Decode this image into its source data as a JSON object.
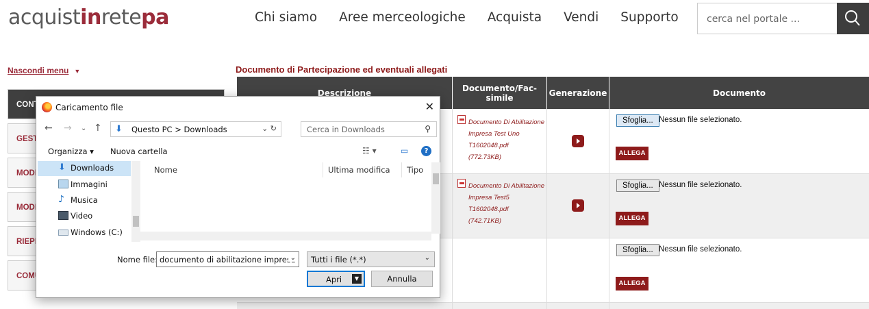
{
  "header": {
    "logo_part1": "acquist",
    "logo_part2": "in",
    "logo_part3": "rete",
    "logo_part4": "pa",
    "nav": [
      "Chi siamo",
      "Aree merceologiche",
      "Acquista",
      "Vendi",
      "Supporto"
    ],
    "search_placeholder": "cerca nel portale ...",
    "search_icon": "search-icon"
  },
  "sidebar": {
    "hide_menu": "Nascondi menu",
    "items": [
      "CONT",
      "GEST",
      "MODI",
      "MODI",
      "RIEPI",
      "COMU"
    ]
  },
  "main": {
    "title": "Documento di Partecipazione ed eventuali allegati",
    "columns": [
      "Descrizione",
      "Documento/Fac-simile",
      "Generazione",
      "Documento"
    ],
    "rows": [
      {
        "doc_name": "Documento Di Abilitazione Impresa Test Uno T1602048.pdf",
        "doc_size": "(772.73KB)"
      },
      {
        "doc_name": "Documento Di Abilitazione Impresa Test5 T1602048.pdf",
        "doc_size": "(742.71KB)"
      },
      {
        "doc_name": "",
        "doc_size": ""
      }
    ],
    "browse_label": "Sfoglia...",
    "no_file": "Nessun file selezionato.",
    "attach_label": "ALLEGA"
  },
  "dialog": {
    "title": "Caricamento file",
    "path": "Questo PC  >  Downloads",
    "search_placeholder": "Cerca in Downloads",
    "organize": "Organizza ▾",
    "new_folder": "Nuova cartella",
    "side_items": [
      "Downloads",
      "Immagini",
      "Musica",
      "Video",
      "Windows (C:)"
    ],
    "columns": [
      "Nome",
      "Ultima modifica",
      "Tipo"
    ],
    "file_name_label": "Nome file:",
    "file_name_value": "documento di abilitazione impresa t",
    "file_type": "Tutti i file (*.*)",
    "open_label": "Apri",
    "cancel_label": "Annulla"
  },
  "colors": {
    "brand": "#9b2c3a",
    "header_dark": "#434343",
    "dialog_accent": "#0078d4"
  }
}
